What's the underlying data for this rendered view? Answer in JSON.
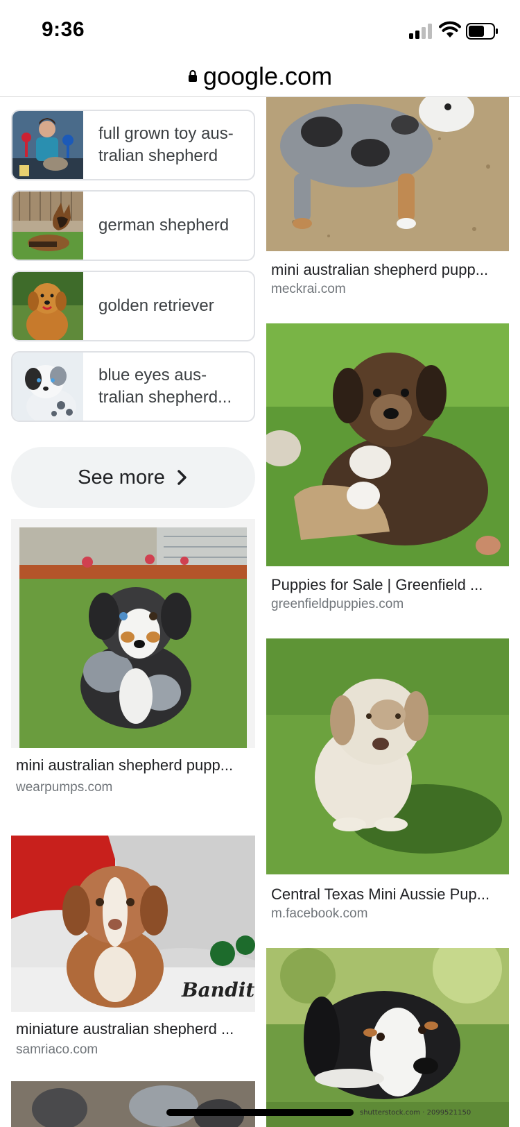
{
  "status_bar": {
    "time": "9:36"
  },
  "address_bar": {
    "url": "google.com"
  },
  "related_searches": [
    {
      "label": "full grown toy aus-\ntralian shepherd"
    },
    {
      "label": "german shepherd"
    },
    {
      "label": "golden retriever"
    },
    {
      "label": "blue eyes aus-\ntralian shepherd..."
    }
  ],
  "see_more": {
    "label": "See more"
  },
  "results": [
    {
      "title": "mini australian shepherd pupp...",
      "source": "meckrai.com"
    },
    {
      "title": "Puppies for Sale | Greenfield ...",
      "source": "greenfieldpuppies.com"
    },
    {
      "title": "Central Texas Mini Aussie Pup...",
      "source": "m.facebook.com"
    },
    {
      "title": "mini australian shepherd pupp...",
      "source": "wearpumps.com"
    },
    {
      "title": "miniature australian shepherd ...",
      "source": "samriaco.com"
    }
  ],
  "image_texts": {
    "signature": "Bandit",
    "watermark": "shutterstock.com · 2099521150"
  }
}
